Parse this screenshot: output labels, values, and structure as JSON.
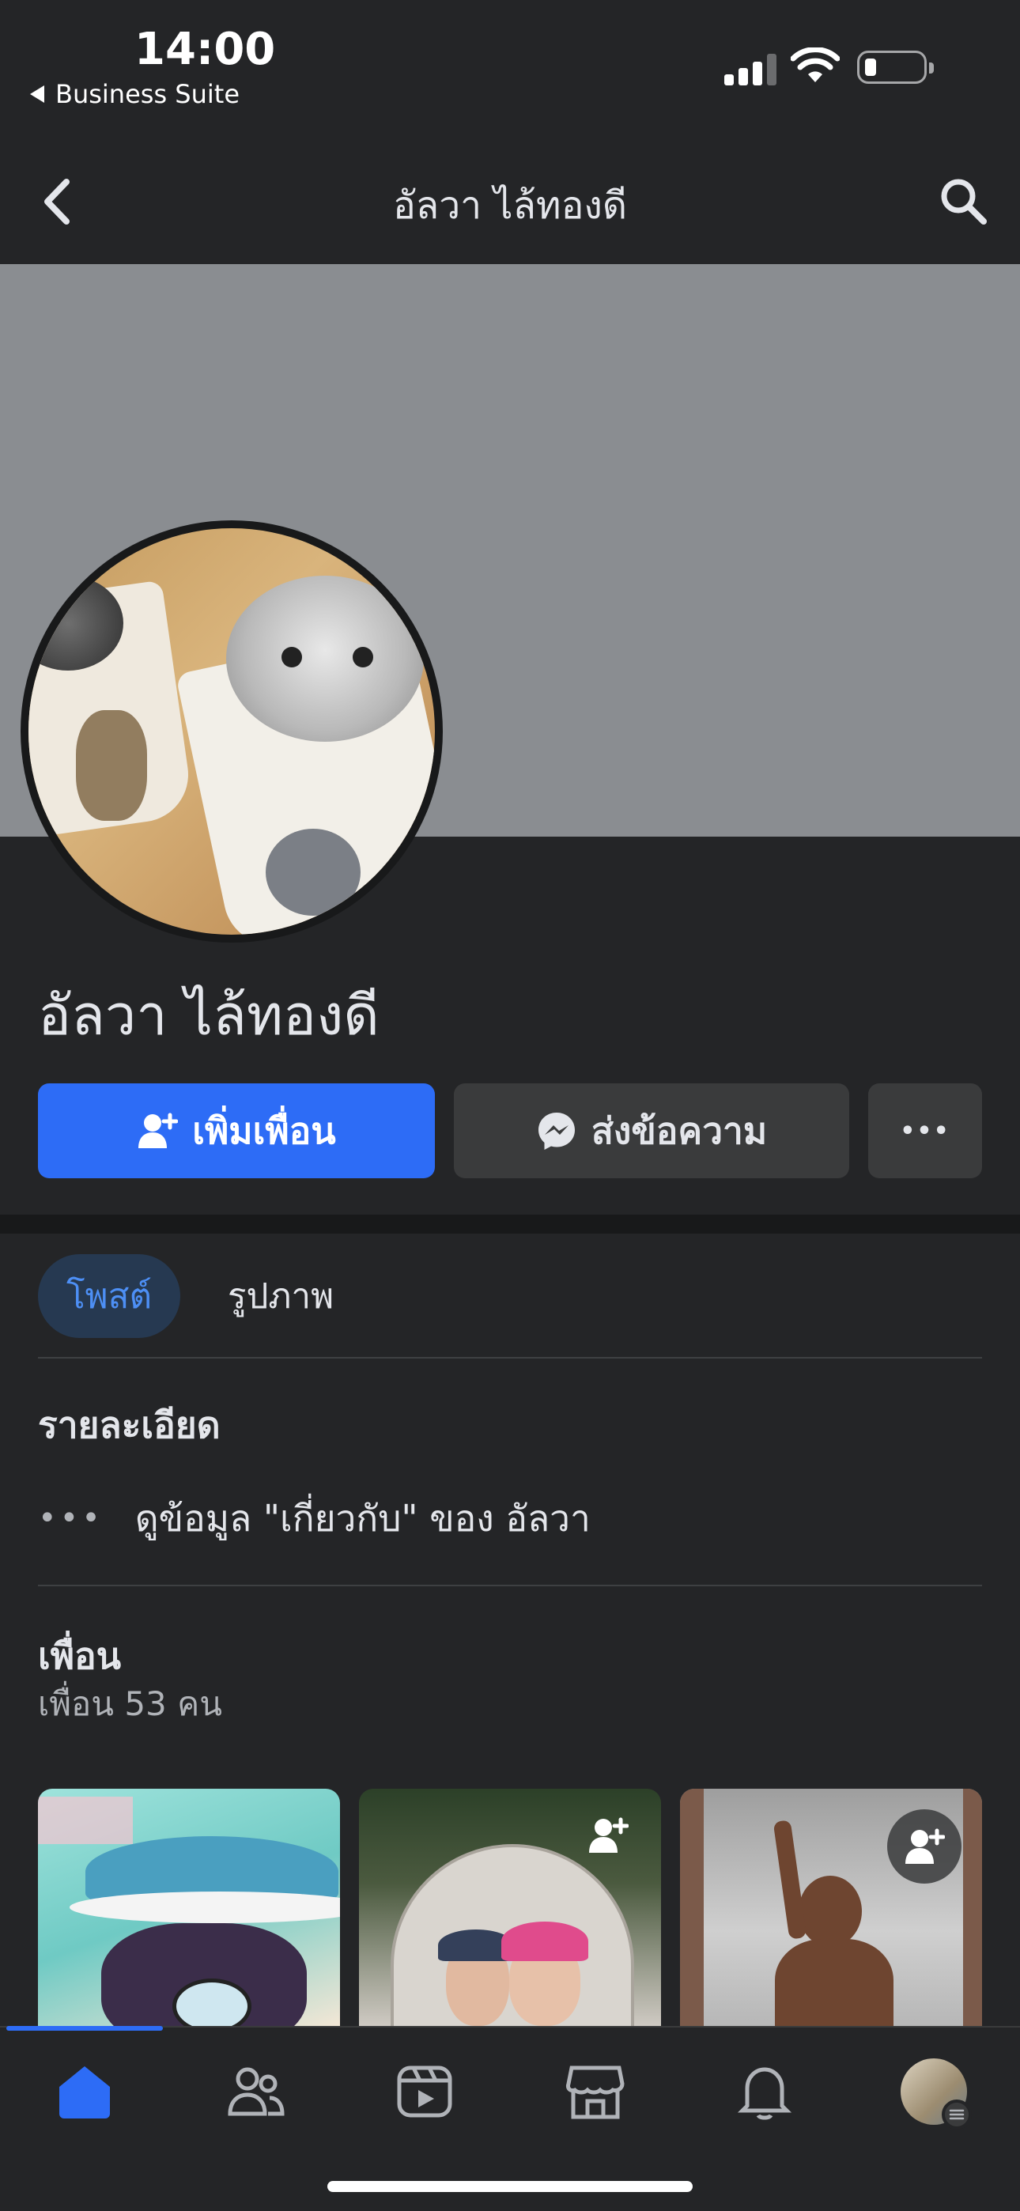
{
  "status_bar": {
    "time": "14:00",
    "back_app": "Business Suite"
  },
  "nav": {
    "title": "อัลวา ไล้ทองดี"
  },
  "profile": {
    "name": "อัลวา ไล้ทองดี"
  },
  "actions": {
    "add_friend": "เพิ่มเพื่อน",
    "message": "ส่งข้อความ",
    "more": "•••"
  },
  "tabs": [
    {
      "label": "โพสต์",
      "active": true
    },
    {
      "label": "รูปภาพ",
      "active": false
    }
  ],
  "details": {
    "title": "รายละเอียด",
    "about_dots": "•••",
    "about_link": "ดูข้อมูล \"เกี่ยวกับ\" ของ อัลวา"
  },
  "friends": {
    "title": "เพื่อน",
    "count_text": "เพื่อน 53 คน"
  },
  "bottom_nav": [
    "home-icon",
    "friends-icon",
    "video-icon",
    "marketplace-icon",
    "notifications-icon",
    "profile-menu-icon"
  ],
  "colors": {
    "accent": "#2d6cf6",
    "background": "#242527",
    "cover": "#8a8d91"
  }
}
